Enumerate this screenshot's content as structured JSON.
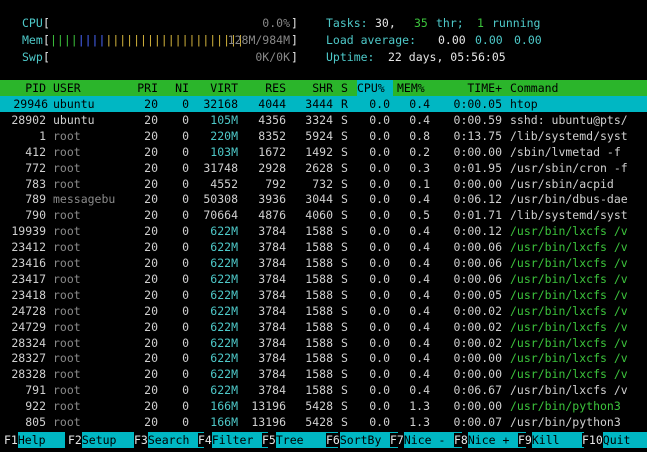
{
  "meters": {
    "cpu": {
      "label": "CPU",
      "value": "0.0%"
    },
    "mem": {
      "label": "Mem",
      "value": "128M/984M"
    },
    "swp": {
      "label": "Swp",
      "value": "0K/0K"
    }
  },
  "summary": {
    "tasks_label": "Tasks:",
    "tasks_value": "30,",
    "thr_value": "35",
    "thr_label": "thr;",
    "running_value": "1",
    "running_label": "running",
    "load_label": "Load average:",
    "load1": "0.00",
    "load5": "0.00",
    "load15": "0.00",
    "uptime_label": "Uptime:",
    "uptime_value": "22 days, 05:56:05"
  },
  "columns": {
    "pid": "PID",
    "user": "USER",
    "pri": "PRI",
    "ni": "NI",
    "virt": "VIRT",
    "res": "RES",
    "shr": "SHR",
    "s": "S",
    "cpu": "CPU%",
    "mem": "MEM%",
    "time": "TIME+",
    "cmd": "Command"
  },
  "processes": [
    {
      "pid": "29946",
      "user": "ubuntu",
      "pri": "20",
      "ni": "0",
      "virt": "32168",
      "res": "4044",
      "shr": "3444",
      "s": "R",
      "cpu": "0.0",
      "mem": "0.4",
      "time": "0:00.05",
      "cmd": "htop",
      "selected": true
    },
    {
      "pid": "28902",
      "user": "ubuntu",
      "pri": "20",
      "ni": "0",
      "virt": "105M",
      "res": "4356",
      "shr": "3324",
      "s": "S",
      "cpu": "0.0",
      "mem": "0.4",
      "time": "0:00.59",
      "cmd": "sshd: ubuntu@pts/"
    },
    {
      "pid": "1",
      "user": "root",
      "pri": "20",
      "ni": "0",
      "virt": "220M",
      "res": "8352",
      "shr": "5924",
      "s": "S",
      "cpu": "0.0",
      "mem": "0.8",
      "time": "0:13.75",
      "cmd": "/lib/systemd/syst"
    },
    {
      "pid": "412",
      "user": "root",
      "pri": "20",
      "ni": "0",
      "virt": "103M",
      "res": "1672",
      "shr": "1492",
      "s": "S",
      "cpu": "0.0",
      "mem": "0.2",
      "time": "0:00.00",
      "cmd": "/sbin/lvmetad -f"
    },
    {
      "pid": "772",
      "user": "root",
      "pri": "20",
      "ni": "0",
      "virt": "31748",
      "res": "2928",
      "shr": "2628",
      "s": "S",
      "cpu": "0.0",
      "mem": "0.3",
      "time": "0:01.95",
      "cmd": "/usr/sbin/cron -f"
    },
    {
      "pid": "783",
      "user": "root",
      "pri": "20",
      "ni": "0",
      "virt": "4552",
      "res": "792",
      "shr": "732",
      "s": "S",
      "cpu": "0.0",
      "mem": "0.1",
      "time": "0:00.00",
      "cmd": "/usr/sbin/acpid"
    },
    {
      "pid": "789",
      "user": "messagebu",
      "pri": "20",
      "ni": "0",
      "virt": "50308",
      "res": "3936",
      "shr": "3044",
      "s": "S",
      "cpu": "0.0",
      "mem": "0.4",
      "time": "0:06.12",
      "cmd": "/usr/bin/dbus-dae"
    },
    {
      "pid": "790",
      "user": "root",
      "pri": "20",
      "ni": "0",
      "virt": "70664",
      "res": "4876",
      "shr": "4060",
      "s": "S",
      "cpu": "0.0",
      "mem": "0.5",
      "time": "0:01.71",
      "cmd": "/lib/systemd/syst"
    },
    {
      "pid": "19939",
      "user": "root",
      "pri": "20",
      "ni": "0",
      "virt": "622M",
      "res": "3784",
      "shr": "1588",
      "s": "S",
      "cpu": "0.0",
      "mem": "0.4",
      "time": "0:00.12",
      "cmd": "/usr/bin/lxcfs /v",
      "thread": true
    },
    {
      "pid": "23412",
      "user": "root",
      "pri": "20",
      "ni": "0",
      "virt": "622M",
      "res": "3784",
      "shr": "1588",
      "s": "S",
      "cpu": "0.0",
      "mem": "0.4",
      "time": "0:00.06",
      "cmd": "/usr/bin/lxcfs /v",
      "thread": true
    },
    {
      "pid": "23416",
      "user": "root",
      "pri": "20",
      "ni": "0",
      "virt": "622M",
      "res": "3784",
      "shr": "1588",
      "s": "S",
      "cpu": "0.0",
      "mem": "0.4",
      "time": "0:00.06",
      "cmd": "/usr/bin/lxcfs /v",
      "thread": true
    },
    {
      "pid": "23417",
      "user": "root",
      "pri": "20",
      "ni": "0",
      "virt": "622M",
      "res": "3784",
      "shr": "1588",
      "s": "S",
      "cpu": "0.0",
      "mem": "0.4",
      "time": "0:00.06",
      "cmd": "/usr/bin/lxcfs /v",
      "thread": true
    },
    {
      "pid": "23418",
      "user": "root",
      "pri": "20",
      "ni": "0",
      "virt": "622M",
      "res": "3784",
      "shr": "1588",
      "s": "S",
      "cpu": "0.0",
      "mem": "0.4",
      "time": "0:00.05",
      "cmd": "/usr/bin/lxcfs /v",
      "thread": true
    },
    {
      "pid": "24728",
      "user": "root",
      "pri": "20",
      "ni": "0",
      "virt": "622M",
      "res": "3784",
      "shr": "1588",
      "s": "S",
      "cpu": "0.0",
      "mem": "0.4",
      "time": "0:00.02",
      "cmd": "/usr/bin/lxcfs /v",
      "thread": true
    },
    {
      "pid": "24729",
      "user": "root",
      "pri": "20",
      "ni": "0",
      "virt": "622M",
      "res": "3784",
      "shr": "1588",
      "s": "S",
      "cpu": "0.0",
      "mem": "0.4",
      "time": "0:00.02",
      "cmd": "/usr/bin/lxcfs /v",
      "thread": true
    },
    {
      "pid": "28324",
      "user": "root",
      "pri": "20",
      "ni": "0",
      "virt": "622M",
      "res": "3784",
      "shr": "1588",
      "s": "S",
      "cpu": "0.0",
      "mem": "0.4",
      "time": "0:00.02",
      "cmd": "/usr/bin/lxcfs /v",
      "thread": true
    },
    {
      "pid": "28327",
      "user": "root",
      "pri": "20",
      "ni": "0",
      "virt": "622M",
      "res": "3784",
      "shr": "1588",
      "s": "S",
      "cpu": "0.0",
      "mem": "0.4",
      "time": "0:00.00",
      "cmd": "/usr/bin/lxcfs /v",
      "thread": true
    },
    {
      "pid": "28328",
      "user": "root",
      "pri": "20",
      "ni": "0",
      "virt": "622M",
      "res": "3784",
      "shr": "1588",
      "s": "S",
      "cpu": "0.0",
      "mem": "0.4",
      "time": "0:00.00",
      "cmd": "/usr/bin/lxcfs /v",
      "thread": true
    },
    {
      "pid": "791",
      "user": "root",
      "pri": "20",
      "ni": "0",
      "virt": "622M",
      "res": "3784",
      "shr": "1588",
      "s": "S",
      "cpu": "0.0",
      "mem": "0.4",
      "time": "0:06.67",
      "cmd": "/usr/bin/lxcfs /v"
    },
    {
      "pid": "922",
      "user": "root",
      "pri": "20",
      "ni": "0",
      "virt": "166M",
      "res": "13196",
      "shr": "5428",
      "s": "S",
      "cpu": "0.0",
      "mem": "1.3",
      "time": "0:00.00",
      "cmd": "/usr/bin/python3",
      "thread": true
    },
    {
      "pid": "805",
      "user": "root",
      "pri": "20",
      "ni": "0",
      "virt": "166M",
      "res": "13196",
      "shr": "5428",
      "s": "S",
      "cpu": "0.0",
      "mem": "1.3",
      "time": "0:00.07",
      "cmd": "/usr/bin/python3"
    }
  ],
  "fkeys": [
    {
      "key": "F1",
      "label": "Help"
    },
    {
      "key": "F2",
      "label": "Setup"
    },
    {
      "key": "F3",
      "label": "Search"
    },
    {
      "key": "F4",
      "label": "Filter"
    },
    {
      "key": "F5",
      "label": "Tree"
    },
    {
      "key": "F6",
      "label": "SortBy"
    },
    {
      "key": "F7",
      "label": "Nice -"
    },
    {
      "key": "F8",
      "label": "Nice +"
    },
    {
      "key": "F9",
      "label": "Kill"
    },
    {
      "key": "F10",
      "label": "Quit"
    }
  ],
  "colors": {
    "header_bg": "#2bb52b",
    "selected_bg": "#00b7c3",
    "accent": "#4ec9c9"
  }
}
